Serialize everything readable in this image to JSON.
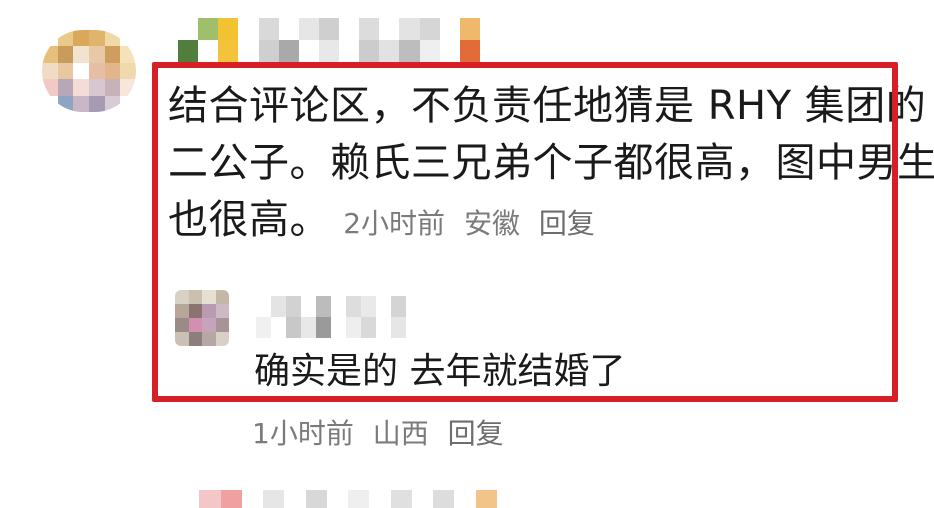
{
  "comment": {
    "text_lines": [
      "结合评论区，不负责任地猜是 RHY 集团的",
      "二公子。赖氏三兄弟个子都很高，图中男生",
      "也很高。"
    ],
    "time": "2小时前",
    "location": "安徽",
    "reply_label": "回复"
  },
  "reply": {
    "text": "确实是的 去年就结婚了",
    "time": "1小时前",
    "location": "山西",
    "reply_label": "回复"
  },
  "colors": {
    "highlight_border": "#d61f26",
    "text": "#1a1a1a",
    "meta_text": "#7b7b7b"
  },
  "icons": {
    "main_avatar": "avatar-icon",
    "reply_avatar": "avatar-icon"
  }
}
